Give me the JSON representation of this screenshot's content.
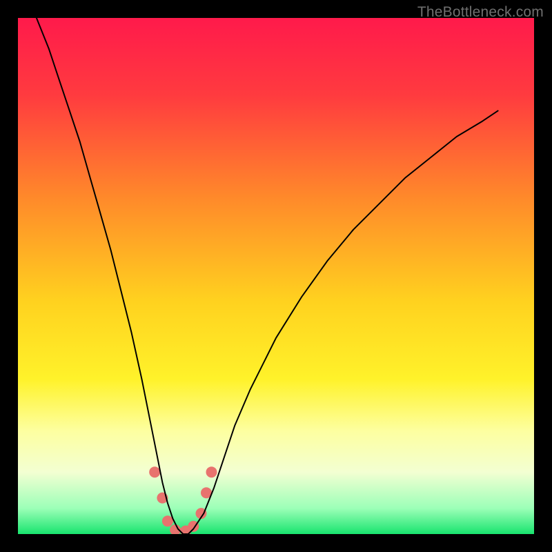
{
  "watermark": "TheBottleneck.com",
  "chart_data": {
    "type": "line",
    "title": "",
    "xlabel": "",
    "ylabel": "",
    "xlim": [
      0,
      100
    ],
    "ylim": [
      0,
      100
    ],
    "background_gradient": {
      "stops": [
        {
          "offset": 0.0,
          "color": "#ff1a4b"
        },
        {
          "offset": 0.15,
          "color": "#ff3b3f"
        },
        {
          "offset": 0.35,
          "color": "#ff8a2a"
        },
        {
          "offset": 0.55,
          "color": "#ffd21f"
        },
        {
          "offset": 0.7,
          "color": "#fff22a"
        },
        {
          "offset": 0.8,
          "color": "#fdffa0"
        },
        {
          "offset": 0.88,
          "color": "#f3ffd2"
        },
        {
          "offset": 0.95,
          "color": "#9cffb8"
        },
        {
          "offset": 1.0,
          "color": "#18e46e"
        }
      ]
    },
    "series": [
      {
        "name": "bottleneck-curve",
        "type": "line",
        "color": "#000000",
        "width": 2,
        "x": [
          0,
          2,
          4,
          6,
          8,
          10,
          12,
          14,
          16,
          18,
          20,
          22,
          24,
          26,
          28,
          29,
          30,
          31,
          32,
          33,
          34,
          36,
          38,
          40,
          42,
          45,
          50,
          55,
          60,
          65,
          70,
          75,
          80,
          85,
          90,
          93
        ],
        "y": [
          108,
          104,
          99,
          94,
          88,
          82,
          76,
          69,
          62,
          55,
          47,
          39,
          30,
          20,
          10,
          6,
          3,
          1,
          0,
          0,
          1,
          4,
          9,
          15,
          21,
          28,
          38,
          46,
          53,
          59,
          64,
          69,
          73,
          77,
          80,
          82
        ]
      }
    ],
    "markers": {
      "name": "highlight-dots",
      "color": "#e8736e",
      "radius": 8,
      "points": [
        {
          "x": 26.5,
          "y": 12
        },
        {
          "x": 28.0,
          "y": 7
        },
        {
          "x": 29.0,
          "y": 2.5
        },
        {
          "x": 30.5,
          "y": 0.8
        },
        {
          "x": 32.5,
          "y": 0.6
        },
        {
          "x": 34.0,
          "y": 1.5
        },
        {
          "x": 35.5,
          "y": 4
        },
        {
          "x": 36.5,
          "y": 8
        },
        {
          "x": 37.5,
          "y": 12
        }
      ]
    }
  }
}
